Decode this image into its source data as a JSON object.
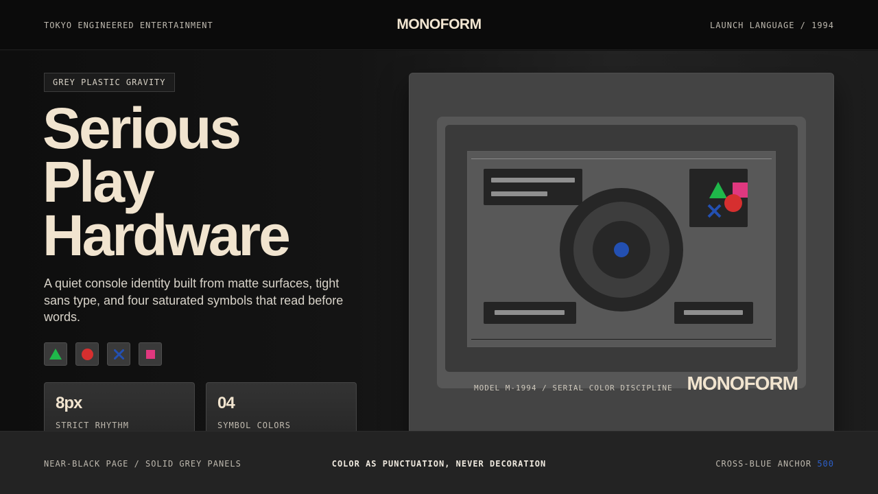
{
  "header": {
    "left": "TOKYO ENGINEERED ENTERTAINMENT",
    "brand": "MONOFORM",
    "right": "LAUNCH LANGUAGE / 1994"
  },
  "hero": {
    "tag": "GREY PLASTIC GRAVITY",
    "headline": [
      "Serious",
      "Play",
      "Hardware"
    ],
    "description": "A quiet console identity built from matte surfaces, tight sans type, and four saturated symbols that read before words.",
    "symbols": [
      "triangle-icon",
      "circle-icon",
      "cross-icon",
      "square-icon"
    ]
  },
  "stats": [
    {
      "value": "8px",
      "label": "STRICT RHYTHM"
    },
    {
      "value": "04",
      "label": "SYMBOL COLORS"
    }
  ],
  "device": {
    "model": "MODEL M-1994 / SERIAL COLOR DISCIPLINE",
    "brand": "MONOFORM"
  },
  "footer": {
    "left": "NEAR-BLACK PAGE / SOLID GREY PANELS",
    "center": "COLOR AS PUNCTUATION, NEVER DECORATION",
    "right_label": "CROSS-BLUE ANCHOR",
    "right_value": "500"
  },
  "colors": {
    "triangle": "#1fb84a",
    "circle": "#d62f2f",
    "cross": "#2350b2",
    "square": "#e0387f",
    "cream": "#f1e4cf"
  }
}
